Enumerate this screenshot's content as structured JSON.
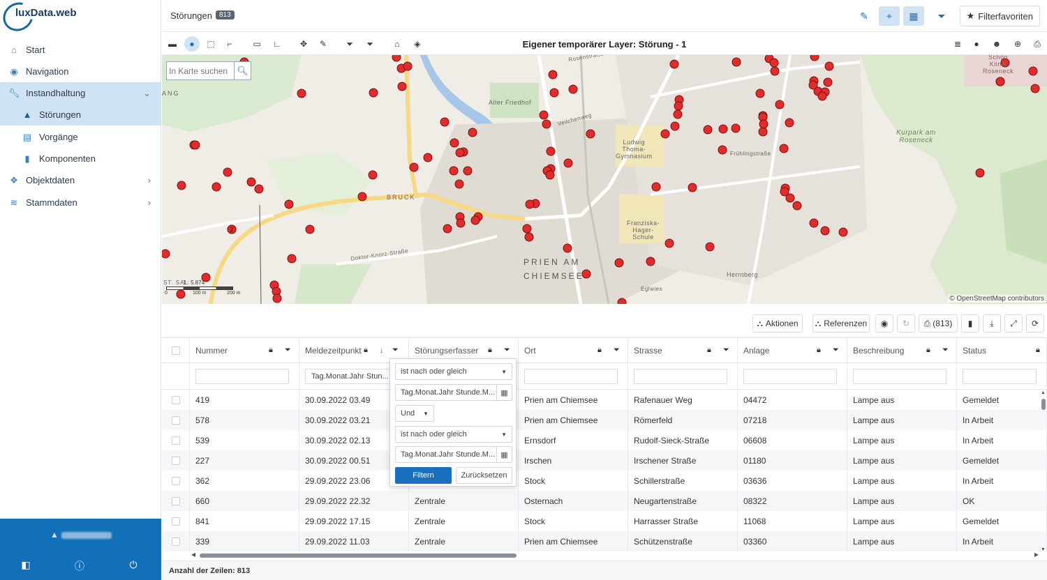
{
  "app": {
    "logo_text": "luxData.web"
  },
  "sidebar": {
    "items": [
      {
        "label": "Start",
        "icon": "home-icon"
      },
      {
        "label": "Navigation",
        "icon": "compass-icon"
      },
      {
        "label": "Instandhaltung",
        "icon": "wrench-icon",
        "expanded": true
      },
      {
        "label": "Störungen",
        "icon": "warning-icon",
        "active": true
      },
      {
        "label": "Vorgänge",
        "icon": "list-icon"
      },
      {
        "label": "Komponenten",
        "icon": "file-icon"
      },
      {
        "label": "Objektdaten",
        "icon": "cubes-icon"
      },
      {
        "label": "Stammdaten",
        "icon": "database-icon"
      }
    ],
    "footer": {
      "user_chevron": "▲"
    }
  },
  "header": {
    "title": "Störungen",
    "badge": "813",
    "filter_favorites": "Filterfavoriten"
  },
  "map_toolbar": {
    "layer_title": "Eigener temporärer Layer: Störung - 1"
  },
  "map": {
    "search_placeholder": "In Karte suchen",
    "attribution": "© OpenStreetMap contributors",
    "scale": {
      "ratio": "1 : 5.874",
      "m100": "100 m",
      "m200": "200 m",
      "zero": "0"
    },
    "labels": {
      "prien": "PRIEN AM",
      "chiemsee": "CHIEMSEE",
      "bruck": "BRUCK",
      "alter_friedhof": "Alter Friedhof",
      "gymnasium": "Ludwig\nThoma-\nGymnasium",
      "schule": "Franziska-\nHager-\nSchule",
      "kurpark": "Kurpark am\nRoseneck",
      "klinik": "Schön\nKlinik\nRoseneck",
      "herrnberg": "Herrnberg",
      "doktor": "Doktor-Knorz-Straße",
      "fruehling": "Frühlingstraße",
      "veilchen": "Veilchenweg",
      "rosen": "Rosenstraße",
      "egl": "Eglwies",
      "ang": "ANG",
      "stsal": "ST. SAL"
    },
    "cluster_label": "2"
  },
  "table_toolbar": {
    "actions": "Aktionen",
    "references": "Referenzen",
    "print_count": "(813)"
  },
  "table": {
    "columns": [
      "Nummer",
      "Meldezeitpunkt",
      "Störungserfasser",
      "Ort",
      "Strasse",
      "Anlage",
      "Beschreibung",
      "Status"
    ],
    "date_filter_placeholder": "Tag.Monat.Jahr Stun...",
    "rows": [
      [
        "419",
        "30.09.2022 03.49",
        "",
        "Prien am Chiemsee",
        "Rafenauer Weg",
        "04472",
        "Lampe aus",
        "Gemeldet"
      ],
      [
        "578",
        "30.09.2022 03.21",
        "",
        "Prien am Chiemsee",
        "Römerfeld",
        "07218",
        "Lampe aus",
        "In Arbeit"
      ],
      [
        "539",
        "30.09.2022 02.13",
        "",
        "Ernsdorf",
        "Rudolf-Sieck-Straße",
        "06608",
        "Lampe aus",
        "In Arbeit"
      ],
      [
        "227",
        "30.09.2022 00.51",
        "",
        "Irschen",
        "Irschener Straße",
        "01180",
        "Lampe aus",
        "Gemeldet"
      ],
      [
        "362",
        "29.09.2022 23.06",
        "",
        "Stock",
        "Schillerstraße",
        "03636",
        "Lampe aus",
        "In Arbeit"
      ],
      [
        "660",
        "29.09.2022 22.32",
        "Zentrale",
        "Osternach",
        "Neugartenstraße",
        "08322",
        "Lampe aus",
        "OK"
      ],
      [
        "841",
        "29.09.2022 17.15",
        "Zentrale",
        "Stock",
        "Harrasser Straße",
        "11068",
        "Lampe aus",
        "Gemeldet"
      ],
      [
        "339",
        "29.09.2022 11.03",
        "Zentrale",
        "Prien am Chiemsee",
        "Schützenstraße",
        "03360",
        "Lampe aus",
        "In Arbeit"
      ]
    ],
    "row_count_label": "Anzahl der Zeilen: 813"
  },
  "filter_popup": {
    "condition1": "ist nach oder gleich",
    "date1": "Tag.Monat.Jahr Stunde.M...",
    "join": "Und",
    "condition2": "ist nach oder gleich",
    "date2": "Tag.Monat.Jahr Stunde.M...",
    "apply": "Filtern",
    "reset": "Zurücksetzen"
  },
  "colors": {
    "accent": "#1a6fbf",
    "sidebar_footer": "#1170b8",
    "marker": "#e32b2b",
    "active_nav": "#cfe3f4"
  }
}
